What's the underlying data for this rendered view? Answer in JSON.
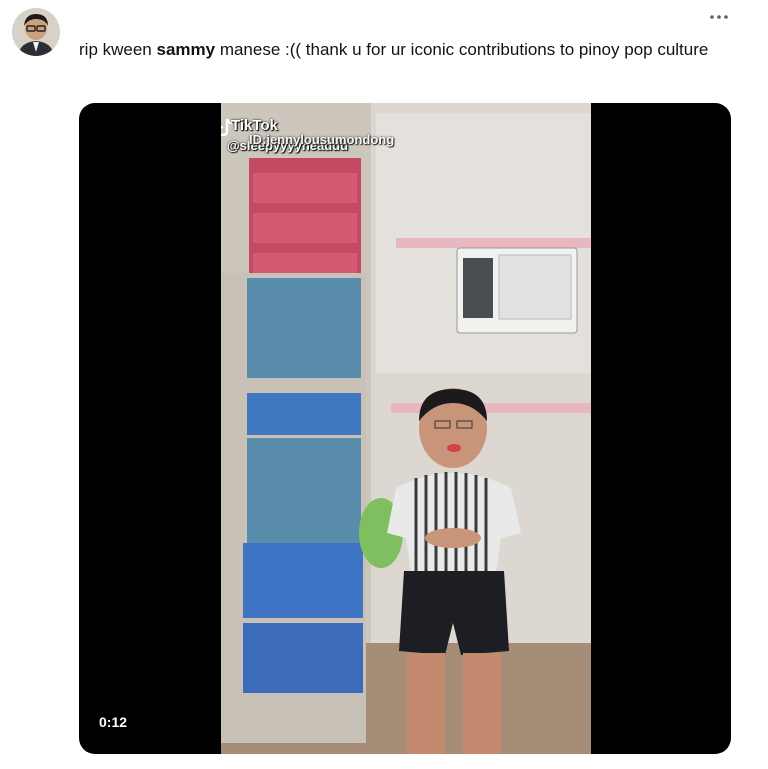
{
  "tweet": {
    "text_before": "rip kween ",
    "text_bold": "sammy",
    "text_after": " manese :(( thank u for ur iconic contributions to pinoy pop culture",
    "more_icon": "more-horizontal-icon",
    "avatar_icon": "profile-avatar"
  },
  "video": {
    "watermark_app": "TikTok",
    "watermark_user": "@sleepyyyyheaddd",
    "watermark_id": "ID:jennylousumondong",
    "timestamp": "0:12",
    "colors": {
      "background": "#000000",
      "wall": "#d8d3cc",
      "floor": "#a58d78"
    }
  }
}
